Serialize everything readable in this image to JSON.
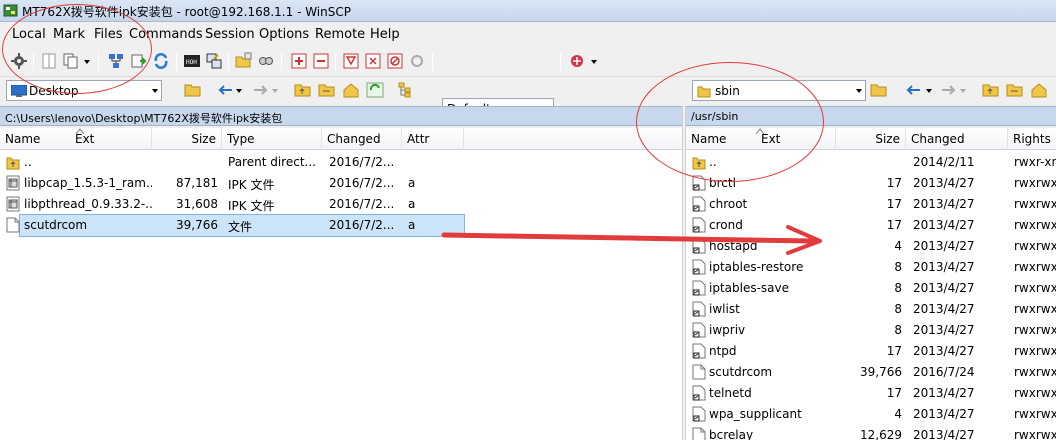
{
  "window": {
    "title": "MT762X拨号软件ipk安装包 - root@192.168.1.1 - WinSCP"
  },
  "menu": [
    "Local",
    "Mark",
    "Files",
    "Commands",
    "Session",
    "Options",
    "Remote",
    "Help"
  ],
  "toolbar": {
    "transfer_setting": "Default"
  },
  "left": {
    "location": "Desktop",
    "path": "C:\\Users\\lenovo\\Desktop\\MT762X拨号软件ipk安装包",
    "columns": [
      "Name",
      "Ext",
      "Size",
      "Type",
      "Changed",
      "Attr"
    ],
    "rows": [
      {
        "name": "..",
        "size": "",
        "type": "Parent direct...",
        "changed": "2016/7/2...",
        "attr": "",
        "icon": "folder-up-icon"
      },
      {
        "name": "libpcap_1.5.3-1_ram...",
        "size": "87,181",
        "type": "IPK 文件",
        "changed": "2016/7/2...",
        "attr": "a",
        "icon": "package-file-icon"
      },
      {
        "name": "libpthread_0.9.33.2-...",
        "size": "31,608",
        "type": "IPK 文件",
        "changed": "2016/7/2...",
        "attr": "a",
        "icon": "package-file-icon"
      },
      {
        "name": "scutdrcom",
        "size": "39,766",
        "type": "文件",
        "changed": "2016/7/2...",
        "attr": "a",
        "icon": "file-icon",
        "selected": true
      }
    ]
  },
  "right": {
    "location": "sbin",
    "path": "/usr/sbin",
    "columns": [
      "Name",
      "Ext",
      "Size",
      "Changed",
      "Rights"
    ],
    "rows": [
      {
        "name": "..",
        "size": "",
        "changed": "2014/2/11",
        "rights": "rwxr-xr",
        "icon": "folder-up-icon"
      },
      {
        "name": "brctl",
        "size": "17",
        "changed": "2013/4/27",
        "rights": "rwxrwx",
        "icon": "link-file-icon"
      },
      {
        "name": "chroot",
        "size": "17",
        "changed": "2013/4/27",
        "rights": "rwxrwx",
        "icon": "link-file-icon"
      },
      {
        "name": "crond",
        "size": "17",
        "changed": "2013/4/27",
        "rights": "rwxrwx",
        "icon": "link-file-icon"
      },
      {
        "name": "hostapd",
        "size": "4",
        "changed": "2013/4/27",
        "rights": "rwxrwx",
        "icon": "link-file-icon"
      },
      {
        "name": "iptables-restore",
        "size": "8",
        "changed": "2013/4/27",
        "rights": "rwxrwx",
        "icon": "link-file-icon"
      },
      {
        "name": "iptables-save",
        "size": "8",
        "changed": "2013/4/27",
        "rights": "rwxrwx",
        "icon": "link-file-icon"
      },
      {
        "name": "iwlist",
        "size": "8",
        "changed": "2013/4/27",
        "rights": "rwxrwx",
        "icon": "link-file-icon"
      },
      {
        "name": "iwpriv",
        "size": "8",
        "changed": "2013/4/27",
        "rights": "rwxrwx",
        "icon": "link-file-icon"
      },
      {
        "name": "ntpd",
        "size": "17",
        "changed": "2013/4/27",
        "rights": "rwxrwx",
        "icon": "link-file-icon"
      },
      {
        "name": "scutdrcom",
        "size": "39,766",
        "changed": "2016/7/24",
        "rights": "rwxrwx",
        "icon": "file-icon"
      },
      {
        "name": "telnetd",
        "size": "17",
        "changed": "2013/4/27",
        "rights": "rwxrwx",
        "icon": "link-file-icon"
      },
      {
        "name": "wpa_supplicant",
        "size": "4",
        "changed": "2013/4/27",
        "rights": "rwxrwx",
        "icon": "link-file-icon"
      },
      {
        "name": "bcrelay",
        "size": "12,629",
        "changed": "2013/4/27",
        "rights": "rwxrwx",
        "icon": "file-icon"
      }
    ]
  },
  "colors": {
    "annotation": "#e23b3b",
    "selection": "#cce4f7",
    "pathbar": "#c8d8ec"
  }
}
